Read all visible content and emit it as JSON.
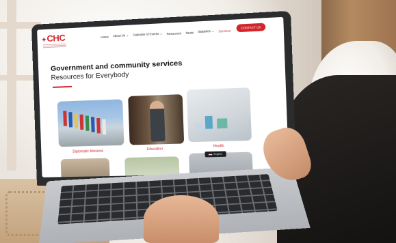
{
  "site": {
    "logo_text": "CHC",
    "nav": [
      {
        "label": "Home"
      },
      {
        "label": "About Us ⌄"
      },
      {
        "label": "Calendar of Events ⌄"
      },
      {
        "label": "Resources"
      },
      {
        "label": "News"
      },
      {
        "label": "Statistics ⌄"
      },
      {
        "label": "Services"
      }
    ],
    "cta_label": "CONTACT US",
    "hero_title": "Government and community services",
    "hero_subtitle": "Resources for Everybody",
    "cards": [
      {
        "label": "Diplomatic Missions"
      },
      {
        "label": "Education"
      },
      {
        "label": "Health"
      }
    ],
    "language": "English",
    "accent_color": "#d0262b"
  }
}
